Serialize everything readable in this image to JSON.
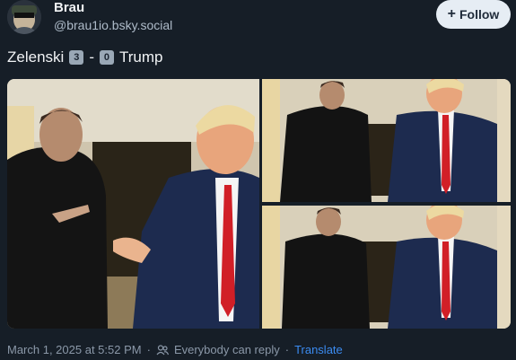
{
  "post": {
    "author_name": "Brau",
    "handle": "@brau1io.bsky.social",
    "follow_label": "Follow",
    "text_before": "Zelenski",
    "score_left": "3",
    "separator": "-",
    "score_right": "0",
    "text_after": "Trump",
    "timestamp": "March 1, 2025 at 5:52 PM",
    "reply_setting": "Everybody can reply",
    "dot": "·",
    "translate_label": "Translate"
  },
  "icons": {
    "avatar": "avatar-image",
    "follow": "plus-icon",
    "reply_setting": "people-icon"
  },
  "colors": {
    "background": "#161e27",
    "link": "#3b8bf0",
    "muted": "#8b98a8",
    "follow_button_bg": "#e6edf4"
  }
}
